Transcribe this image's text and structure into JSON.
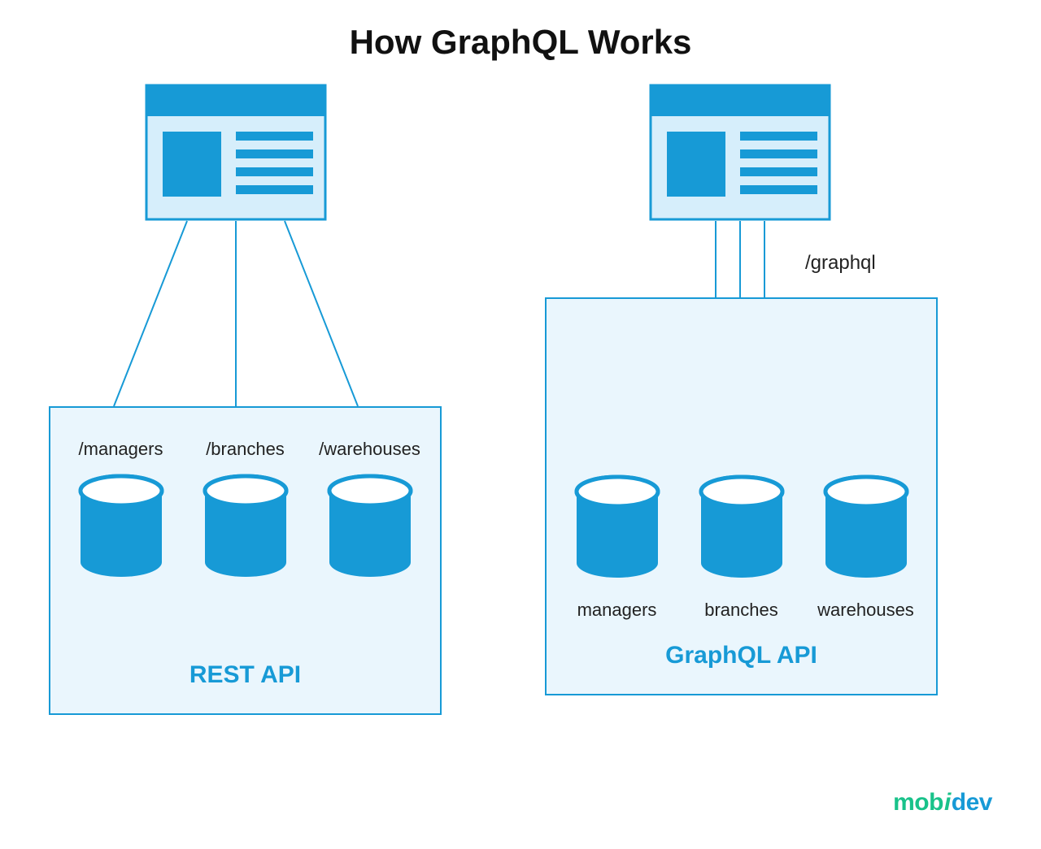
{
  "title": "How GraphQL Works",
  "colors": {
    "primary": "#179ad6",
    "panelBg": "#eaf6fd",
    "pink": "#e6007e",
    "brandGreen": "#19c28a"
  },
  "rest": {
    "label": "REST API",
    "endpoints": [
      "/managers",
      "/branches",
      "/warehouses"
    ]
  },
  "graphql": {
    "label": "GraphQL API",
    "route": "/graphql",
    "entities": [
      "managers",
      "branches",
      "warehouses"
    ]
  },
  "brand": {
    "part1": "mob",
    "slash": "i",
    "part2": "dev"
  }
}
